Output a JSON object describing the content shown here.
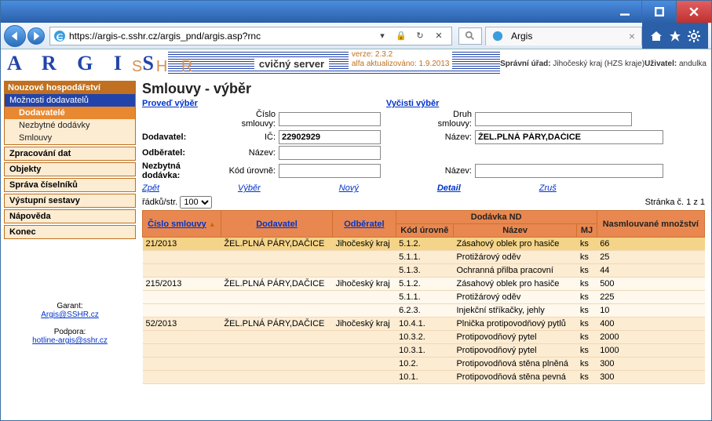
{
  "window": {
    "url": "https://argis-c.sshr.cz/argis_pnd/argis.asp?rnc",
    "tab_title": "Argis"
  },
  "banner": {
    "logo": "A R G I S",
    "shadow": "S H R",
    "cvicny": "cvičný server",
    "verze_line1": "verze: 2.3.2",
    "verze_line2": "alfa aktualizováno: 1.9.2013",
    "spravni_label": "Správní úřad:",
    "spravni_value": "Jihočeský kraj (HZS kraje)",
    "uzivatel_label": "Uživatel:",
    "uzivatel_value": "andulka"
  },
  "side": {
    "nouzove": "Nouzové hospodářství",
    "moznosti": "Možnosti dodavatelů",
    "dodavatele": "Dodavatelé",
    "nezbytne": "Nezbytné dodávky",
    "smlouvy": "Smlouvy",
    "zprac": "Zpracování dat",
    "objekty": "Objekty",
    "sprava": "Správa číselníků",
    "vystup": "Výstupní sestavy",
    "napoveda": "Nápověda",
    "konec": "Konec",
    "garant_label": "Garant:",
    "garant_link": "Argis@SSHR.cz",
    "podpora_label": "Podpora:",
    "podpora_link": "hotline-argis@sshr.cz"
  },
  "page": {
    "title": "Smlouvy - výběr",
    "proved": "Proveď výběr",
    "vycisti": "Vyčisti výběr",
    "labels": {
      "cislo": "Číslo smlouvy:",
      "druh": "Druh smlouvy:",
      "dodavatel": "Dodavatel:",
      "ic": "IČ:",
      "nazev": "Název:",
      "odberatel": "Odběratel:",
      "nezbytna": "Nezbytná dodávka:",
      "kod": "Kód úrovně:"
    },
    "values": {
      "ic": "22902929",
      "dod_nazev": "ŽEL.PLNÁ PÁRY,DAČICE"
    },
    "actions": {
      "zpet": "Zpět",
      "vyber": "Výběr",
      "novy": "Nový",
      "detail": "Detail",
      "zrus": "Zruš"
    },
    "pager": {
      "radku": "řádků/str.",
      "sel": "100",
      "stranka": "Stránka č. 1 z 1"
    },
    "headers": {
      "cislo": "Číslo smlouvy",
      "dod": "Dodavatel",
      "odb": "Odběratel",
      "dodnd": "Dodávka ND",
      "kod": "Kód úrovně",
      "naz": "Název",
      "mj": "MJ",
      "mnoz": "Nasmlouvané množství"
    },
    "rows": [
      {
        "g": 0,
        "cislo": "21/2013",
        "dod": "ŽEL.PLNÁ PÁRY,DAČICE",
        "odb": "Jihočeský kraj",
        "kod": "5.1.2.",
        "naz": "Zásahový oblek pro hasiče",
        "mj": "ks",
        "mnoz": "66",
        "sel": true
      },
      {
        "g": 0,
        "cislo": "",
        "dod": "",
        "odb": "",
        "kod": "5.1.1.",
        "naz": "Protižárový oděv",
        "mj": "ks",
        "mnoz": "25"
      },
      {
        "g": 0,
        "cislo": "",
        "dod": "",
        "odb": "",
        "kod": "5.1.3.",
        "naz": "Ochranná přilba pracovní",
        "mj": "ks",
        "mnoz": "44"
      },
      {
        "g": 1,
        "cislo": "215/2013",
        "dod": "ŽEL.PLNÁ PÁRY,DAČICE",
        "odb": "Jihočeský kraj",
        "kod": "5.1.2.",
        "naz": "Zásahový oblek pro hasiče",
        "mj": "ks",
        "mnoz": "500"
      },
      {
        "g": 1,
        "cislo": "",
        "dod": "",
        "odb": "",
        "kod": "5.1.1.",
        "naz": "Protižárový oděv",
        "mj": "ks",
        "mnoz": "225"
      },
      {
        "g": 1,
        "cislo": "",
        "dod": "",
        "odb": "",
        "kod": "6.2.3.",
        "naz": "Injekční stříkačky, jehly",
        "mj": "ks",
        "mnoz": "10"
      },
      {
        "g": 0,
        "cislo": "52/2013",
        "dod": "ŽEL.PLNÁ PÁRY,DAČICE",
        "odb": "Jihočeský kraj",
        "kod": "10.4.1.",
        "naz": "Plnička protipovodňový pytlů",
        "mj": "ks",
        "mnoz": "400"
      },
      {
        "g": 0,
        "cislo": "",
        "dod": "",
        "odb": "",
        "kod": "10.3.2.",
        "naz": "Protipovodňový pytel",
        "mj": "ks",
        "mnoz": "2000"
      },
      {
        "g": 0,
        "cislo": "",
        "dod": "",
        "odb": "",
        "kod": "10.3.1.",
        "naz": "Protipovodňový pytel",
        "mj": "ks",
        "mnoz": "1000"
      },
      {
        "g": 0,
        "cislo": "",
        "dod": "",
        "odb": "",
        "kod": "10.2.",
        "naz": "Protipovodňová stěna plněná",
        "mj": "ks",
        "mnoz": "300"
      },
      {
        "g": 0,
        "cislo": "",
        "dod": "",
        "odb": "",
        "kod": "10.1.",
        "naz": "Protipovodňová stěna pevná",
        "mj": "ks",
        "mnoz": "300"
      }
    ]
  }
}
